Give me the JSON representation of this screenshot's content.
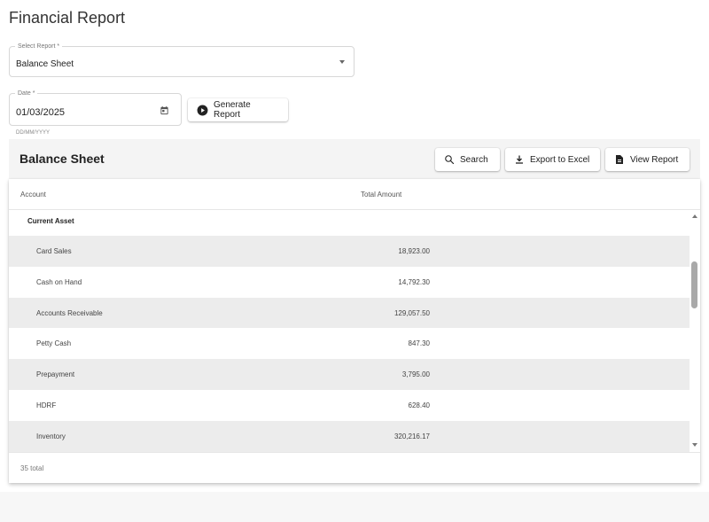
{
  "page": {
    "title": "Financial Report"
  },
  "form": {
    "select_report": {
      "label": "Select Report *",
      "value": "Balance Sheet"
    },
    "date": {
      "label": "Date *",
      "value": "01/03/2025",
      "helper": "DD/MM/YYYY"
    },
    "generate_label": "Generate Report"
  },
  "report": {
    "title": "Balance Sheet",
    "buttons": {
      "search": "Search",
      "export": "Export to Excel",
      "view": "View Report"
    },
    "columns": {
      "account": "Account",
      "total_amount": "Total Amount"
    },
    "group": "Current Asset",
    "rows": [
      {
        "account": "Card Sales",
        "amount": "18,923.00"
      },
      {
        "account": "Cash on Hand",
        "amount": "14,792.30"
      },
      {
        "account": "Accounts Receivable",
        "amount": "129,057.50"
      },
      {
        "account": "Petty Cash",
        "amount": "847.30"
      },
      {
        "account": "Prepayment",
        "amount": "3,795.00"
      },
      {
        "account": "HDRF",
        "amount": "628.40"
      },
      {
        "account": "Inventory",
        "amount": "320,216.17"
      }
    ],
    "footer": "35 total"
  },
  "icons": {
    "calendar": "calendar-icon",
    "play": "play-circle-icon",
    "search": "search-icon",
    "download": "download-icon",
    "document": "document-icon"
  },
  "colors": {
    "header_bg": "#f4f4f4",
    "row_alt": "#ececec",
    "text": "#222222"
  }
}
